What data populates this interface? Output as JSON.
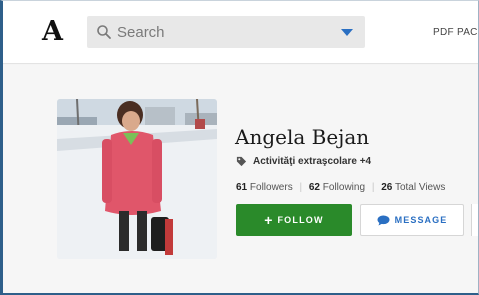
{
  "header": {
    "logo_text": "A",
    "search": {
      "placeholder": "Search",
      "value": ""
    },
    "nav_links": [
      "PDF PACK"
    ]
  },
  "profile": {
    "name": "Angela Bejan",
    "tag": "Activităţi extraşcolare +4",
    "stats": {
      "followers_count": "61",
      "followers_label": "Followers",
      "following_count": "62",
      "following_label": "Following",
      "views_count": "26",
      "views_label": "Total Views"
    },
    "buttons": {
      "follow_label": "FOLLOW",
      "message_label": "MESSAGE"
    }
  },
  "colors": {
    "follow": "#2a8a2a",
    "accent": "#2a6fc2",
    "frame": "#2e5f8a"
  },
  "icons": [
    "search-icon",
    "chevron-down-icon",
    "tag-icon",
    "plus-icon",
    "chat-bubble-icon"
  ]
}
